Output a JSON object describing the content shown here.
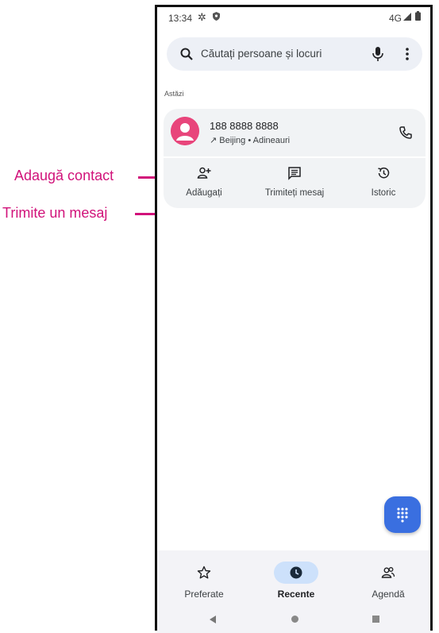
{
  "annotations": {
    "add_contact": "Adaugă contact",
    "send_message": "Trimite un mesaj"
  },
  "status_bar": {
    "time": "13:34",
    "network": "4G",
    "icons": [
      "gear-icon",
      "shield-icon",
      "signal-icon",
      "battery-icon"
    ]
  },
  "search": {
    "placeholder": "Căutați persoane și locuri",
    "icons": [
      "search-icon",
      "mic-icon",
      "more-vert-icon"
    ]
  },
  "section_label": "Astăzi",
  "call": {
    "number": "188 8888 8888",
    "detail": "↗ Beijing • Adineauri",
    "avatar_color": "#e8457b"
  },
  "actions": [
    {
      "label": "Adăugați",
      "icon": "add-person-icon"
    },
    {
      "label": "Trimiteți mesaj",
      "icon": "message-icon"
    },
    {
      "label": "Istoric",
      "icon": "history-icon"
    }
  ],
  "fab": {
    "icon": "dialpad-icon",
    "color": "#3a6fe0"
  },
  "bottom_nav": {
    "items": [
      {
        "label": "Preferate",
        "icon": "star-icon",
        "active": false
      },
      {
        "label": "Recente",
        "icon": "clock-icon",
        "active": true
      },
      {
        "label": "Agendă",
        "icon": "contacts-icon",
        "active": false
      }
    ]
  },
  "accent_color": "#d1127a"
}
